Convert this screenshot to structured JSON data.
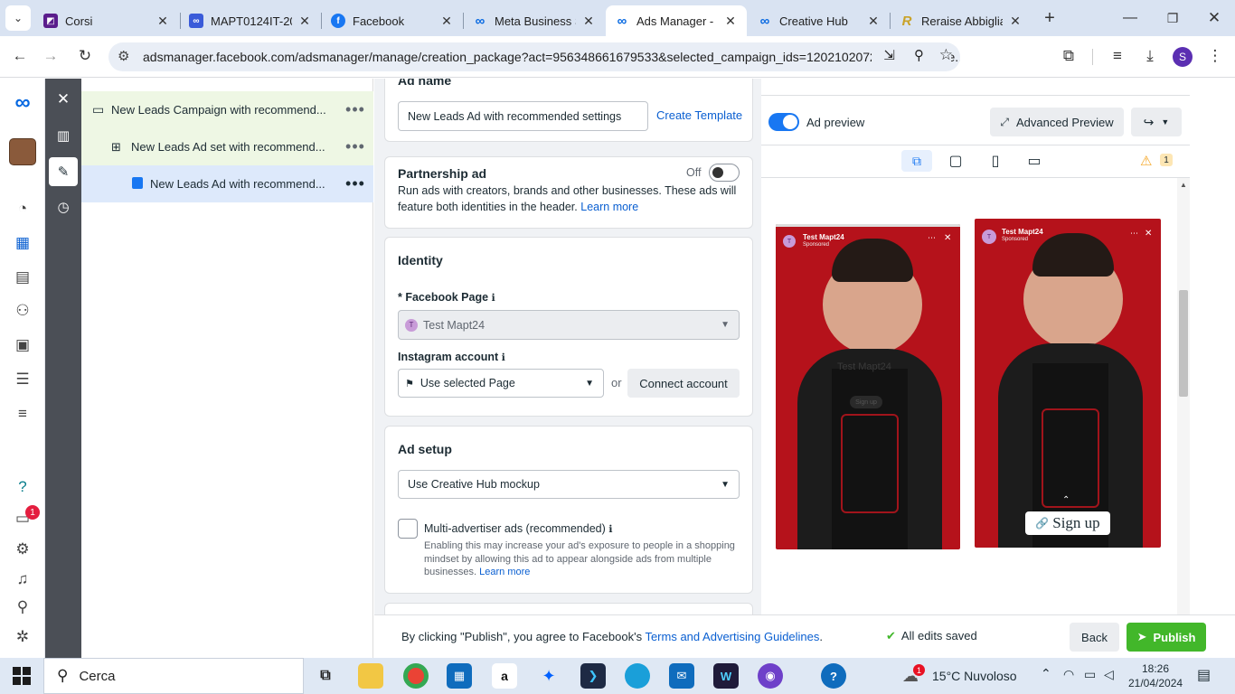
{
  "browser": {
    "tabs": [
      {
        "title": "Corsi",
        "icon": "corsi-favicon",
        "color": "#5a1d8c"
      },
      {
        "title": "MAPT0124IT-20…",
        "icon": "mapt-favicon",
        "color": "#3a5bd9"
      },
      {
        "title": "Facebook",
        "icon": "facebook-favicon",
        "color": "#1877f2"
      },
      {
        "title": "Meta Business S…",
        "icon": "meta-favicon",
        "color": "#0668e1"
      },
      {
        "title": "Ads Manager - I…",
        "icon": "meta-favicon",
        "color": "#0668e1"
      },
      {
        "title": "Creative Hub",
        "icon": "meta-favicon",
        "color": "#0668e1"
      },
      {
        "title": "Reraise Abbiglia…",
        "icon": "reraise-favicon",
        "color": "#c9a227"
      }
    ],
    "url": "adsmanager.facebook.com/adsmanager/manage/creation_package?act=956348661679533&selected_campaign_ids=120210207272970768&se...",
    "profile_initial": "S"
  },
  "rail": {
    "help_badge": "1"
  },
  "tree": {
    "campaign": "New Leads Campaign with recommend...",
    "adset": "New Leads Ad set with recommend...",
    "ad": "New Leads Ad with recommend..."
  },
  "ad_name": {
    "heading": "Ad name",
    "value": "New Leads Ad with recommended settings",
    "template_link": "Create Template"
  },
  "partnership": {
    "title": "Partnership ad",
    "toggle_label": "Off",
    "description": "Run ads with creators, brands and other businesses. These ads will feature both identities in the header.",
    "learn_more": "Learn more"
  },
  "identity": {
    "title": "Identity",
    "facebook_page_label": "* Facebook Page",
    "facebook_page_value": "Test Mapt24",
    "page_avatar": "T",
    "instagram_label": "Instagram account",
    "instagram_value": "Use selected Page",
    "or": "or",
    "connect_button": "Connect account"
  },
  "ad_setup": {
    "title": "Ad setup",
    "select_value": "Use Creative Hub mockup",
    "multi_label": "Multi-advertiser ads (recommended)",
    "multi_desc": "Enabling this may increase your ad's exposure to people in a shopping mindset by allowing this ad to appear alongside ads from multiple businesses.",
    "learn_more": "Learn more"
  },
  "preview": {
    "toggle_label": "Ad preview",
    "advanced_button": "Advanced Preview",
    "warning_count": "1",
    "story_page": "Test Mapt24",
    "story_sponsored": "Sponsored",
    "cta": "Sign up",
    "ghost_page": "Test Mapt24",
    "ghost_cta": "Sign up"
  },
  "footer": {
    "agree_prefix": "By clicking \"Publish\", you agree to Facebook's ",
    "agree_link": "Terms and Advertising Guidelines",
    "agree_suffix": ".",
    "saved": "All edits saved",
    "back": "Back",
    "publish": "Publish"
  },
  "taskbar": {
    "search": "Cerca",
    "weather_temp": "15°C",
    "weather_desc": "Nuvoloso",
    "weather_badge": "1",
    "time": "18:26",
    "date": "21/04/2024"
  },
  "colors": {
    "accent": "#0a5fd1",
    "publish": "#42b72a",
    "story_bg": "#b5121b"
  }
}
